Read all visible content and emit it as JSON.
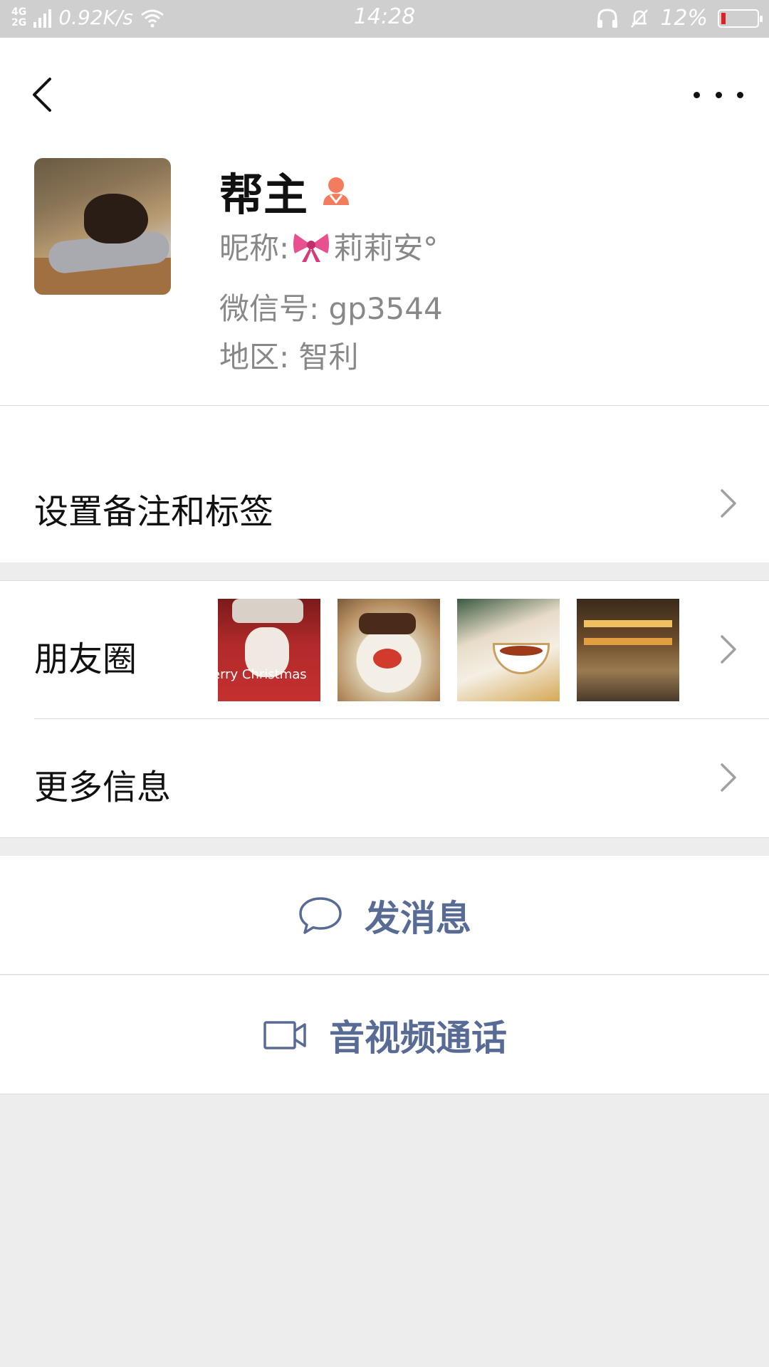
{
  "status_bar": {
    "network_type_top": "4G",
    "network_type_bottom": "2G",
    "speed": "0.92K/s",
    "time": "14:28",
    "battery_percent": "12%",
    "battery_level": 0.12,
    "battery_color": "#e02020"
  },
  "profile": {
    "name": "帮主",
    "gender_icon": "female-icon",
    "gender_color": "#f37b5e",
    "nickname_label": "昵称:",
    "nickname_emoji": "bow-emoji",
    "nickname": "莉莉安°",
    "wechat_id_label": "微信号:",
    "wechat_id": "gp3544",
    "region_label": "地区:",
    "region": "智利"
  },
  "rows": {
    "remark": "设置备注和标签",
    "moments": "朋友圈",
    "more_info": "更多信息"
  },
  "moments_thumbs": {
    "t1_caption": "erry Christmas"
  },
  "actions": {
    "message": "发消息",
    "call": "音视频通话",
    "accent_color": "#576b95"
  }
}
